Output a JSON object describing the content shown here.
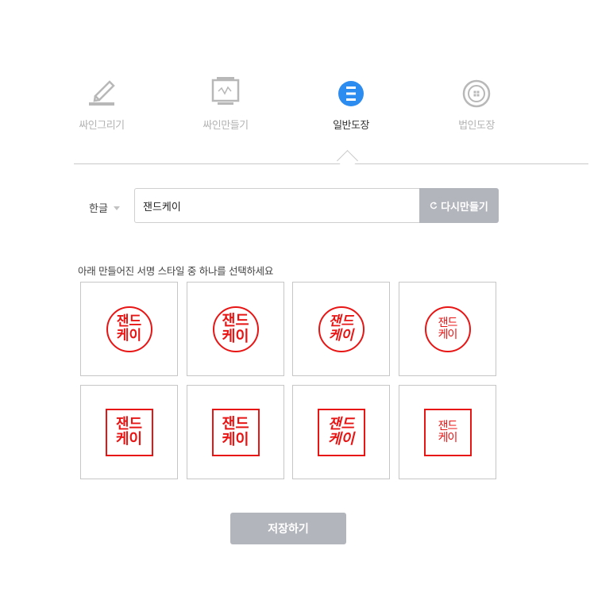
{
  "tabs": [
    {
      "label": "싸인그리기",
      "icon": "pen-draw-icon",
      "active": false
    },
    {
      "label": "싸인만들기",
      "icon": "monitor-sign-icon",
      "active": false
    },
    {
      "label": "일반도장",
      "icon": "stamp-bars-icon",
      "active": true
    },
    {
      "label": "법인도장",
      "icon": "corporate-seal-icon",
      "active": false
    }
  ],
  "language": {
    "selected": "한글"
  },
  "name_input": {
    "value": "잰드케이"
  },
  "regenerate_label": "다시만들기",
  "instruction": "아래 만들어진 서명 스타일 중 하나를 선택하세요",
  "stamps": [
    {
      "shape": "circle",
      "line1": "잰드",
      "line2": "케이"
    },
    {
      "shape": "circle",
      "line1": "잰드",
      "line2": "케이"
    },
    {
      "shape": "circle",
      "line1": "잰드",
      "line2": "케이"
    },
    {
      "shape": "circle",
      "line1": "잰드",
      "line2": "케이"
    },
    {
      "shape": "square",
      "line1": "잰드",
      "line2": "케이"
    },
    {
      "shape": "square",
      "line1": "잰드",
      "line2": "케이"
    },
    {
      "shape": "square",
      "line1": "잰드",
      "line2": "케이"
    },
    {
      "shape": "square",
      "line1": "잰드",
      "line2": "케이"
    }
  ],
  "save_label": "저장하기",
  "colors": {
    "accent": "#2d8cf0",
    "stamp_red": "#e81515",
    "button_gray": "#b3b5bd",
    "inactive_text": "#b3b3b3"
  }
}
